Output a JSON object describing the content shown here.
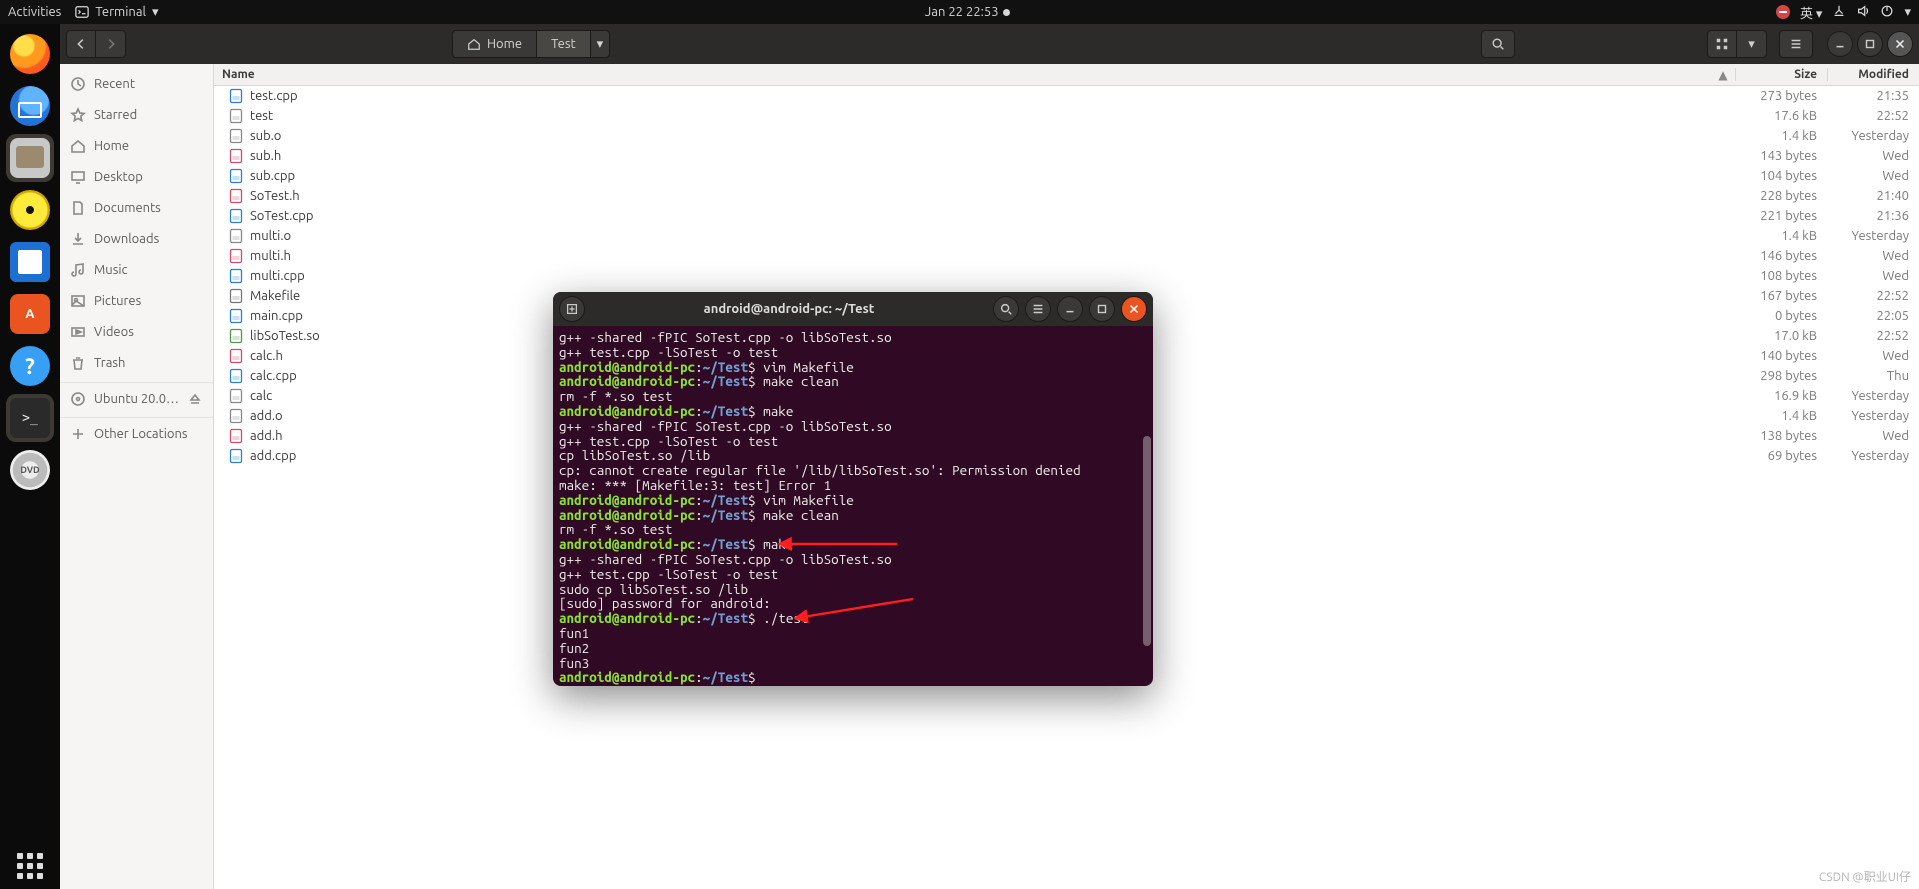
{
  "top_panel": {
    "activities": "Activities",
    "app_label": "Terminal",
    "clock": "Jan 22  22:53",
    "lang": "英"
  },
  "dock": {
    "software_label": "A"
  },
  "fm": {
    "breadcrumb": {
      "home": "Home",
      "current": "Test"
    },
    "sidebar": {
      "recent": "Recent",
      "starred": "Starred",
      "home": "Home",
      "desktop": "Desktop",
      "documents": "Documents",
      "downloads": "Downloads",
      "music": "Music",
      "pictures": "Pictures",
      "videos": "Videos",
      "trash": "Trash",
      "disk": "Ubuntu 20.0…",
      "other": "Other Locations"
    },
    "columns": {
      "name": "Name",
      "size": "Size",
      "modified": "Modified",
      "sort_glyph": "▲"
    },
    "rows": [
      {
        "name": "test.cpp",
        "size": "273 bytes",
        "mod": "21:35",
        "type": "cpp"
      },
      {
        "name": "test",
        "size": "17.6 kB",
        "mod": "22:52",
        "type": "bin"
      },
      {
        "name": "sub.o",
        "size": "1.4 kB",
        "mod": "Yesterday",
        "type": "obj"
      },
      {
        "name": "sub.h",
        "size": "143 bytes",
        "mod": "Wed",
        "type": "h"
      },
      {
        "name": "sub.cpp",
        "size": "104 bytes",
        "mod": "Wed",
        "type": "cpp"
      },
      {
        "name": "SoTest.h",
        "size": "228 bytes",
        "mod": "21:40",
        "type": "h"
      },
      {
        "name": "SoTest.cpp",
        "size": "221 bytes",
        "mod": "21:36",
        "type": "cpp"
      },
      {
        "name": "multi.o",
        "size": "1.4 kB",
        "mod": "Yesterday",
        "type": "obj"
      },
      {
        "name": "multi.h",
        "size": "146 bytes",
        "mod": "Wed",
        "type": "h"
      },
      {
        "name": "multi.cpp",
        "size": "108 bytes",
        "mod": "Wed",
        "type": "cpp"
      },
      {
        "name": "Makefile",
        "size": "167 bytes",
        "mod": "22:52",
        "type": "txt"
      },
      {
        "name": "main.cpp",
        "size": "0 bytes",
        "mod": "22:05",
        "type": "cpp"
      },
      {
        "name": "libSoTest.so",
        "size": "17.0 kB",
        "mod": "22:52",
        "type": "so"
      },
      {
        "name": "calc.h",
        "size": "140 bytes",
        "mod": "Wed",
        "type": "h"
      },
      {
        "name": "calc.cpp",
        "size": "298 bytes",
        "mod": "Thu",
        "type": "cpp"
      },
      {
        "name": "calc",
        "size": "16.9 kB",
        "mod": "Yesterday",
        "type": "bin"
      },
      {
        "name": "add.o",
        "size": "1.4 kB",
        "mod": "Yesterday",
        "type": "obj"
      },
      {
        "name": "add.h",
        "size": "138 bytes",
        "mod": "Wed",
        "type": "h"
      },
      {
        "name": "add.cpp",
        "size": "69 bytes",
        "mod": "Yesterday",
        "type": "cpp"
      }
    ]
  },
  "terminal": {
    "title": "android@android-pc: ~/Test",
    "user": "android@android-pc",
    "path": "~/Test",
    "lines": [
      {
        "t": "out",
        "txt": "g++ -shared -fPIC SoTest.cpp -o libSoTest.so"
      },
      {
        "t": "out",
        "txt": "g++ test.cpp -lSoTest -o test"
      },
      {
        "t": "prompt",
        "cmd": "vim Makefile"
      },
      {
        "t": "prompt",
        "cmd": "make clean"
      },
      {
        "t": "out",
        "txt": "rm -f *.so test"
      },
      {
        "t": "prompt",
        "cmd": "make"
      },
      {
        "t": "out",
        "txt": "g++ -shared -fPIC SoTest.cpp -o libSoTest.so"
      },
      {
        "t": "out",
        "txt": "g++ test.cpp -lSoTest -o test"
      },
      {
        "t": "out",
        "txt": "cp libSoTest.so /lib"
      },
      {
        "t": "out",
        "txt": "cp: cannot create regular file '/lib/libSoTest.so': Permission denied"
      },
      {
        "t": "out",
        "txt": "make: *** [Makefile:3: test] Error 1"
      },
      {
        "t": "prompt",
        "cmd": "vim Makefile"
      },
      {
        "t": "prompt",
        "cmd": "make clean"
      },
      {
        "t": "out",
        "txt": "rm -f *.so test"
      },
      {
        "t": "prompt",
        "cmd": "make"
      },
      {
        "t": "out",
        "txt": "g++ -shared -fPIC SoTest.cpp -o libSoTest.so"
      },
      {
        "t": "out",
        "txt": "g++ test.cpp -lSoTest -o test"
      },
      {
        "t": "out",
        "txt": "sudo cp libSoTest.so /lib"
      },
      {
        "t": "out",
        "txt": "[sudo] password for android: "
      },
      {
        "t": "prompt",
        "cmd": "./test"
      },
      {
        "t": "out",
        "txt": "fun1"
      },
      {
        "t": "out",
        "txt": "fun2"
      },
      {
        "t": "out",
        "txt": "fun3"
      },
      {
        "t": "prompt",
        "cmd": ""
      }
    ]
  },
  "watermark": "CSDN @职业UI仔"
}
